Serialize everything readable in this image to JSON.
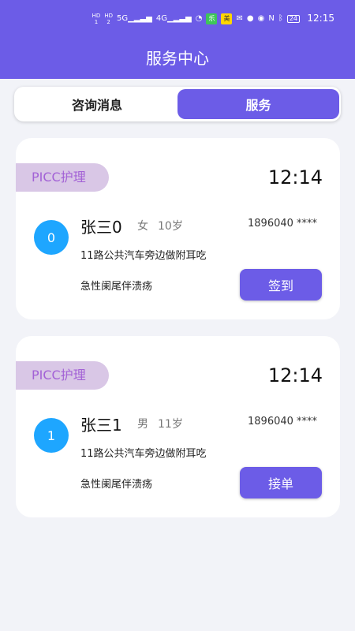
{
  "status_bar": {
    "icons": [
      {
        "name": "hd1-icon",
        "top": "HD",
        "bottom": "1"
      },
      {
        "name": "hd2-icon",
        "top": "HD",
        "bottom": "2"
      },
      {
        "name": "signal-5g-icon",
        "glyph": "5G▁▂▃▅"
      },
      {
        "name": "signal-4g-icon",
        "glyph": "4G▁▂▃▅"
      },
      {
        "name": "wifi-icon",
        "glyph": "◔"
      },
      {
        "name": "app-badge-green-icon",
        "glyph": "乐"
      },
      {
        "name": "app-badge-yellow-icon",
        "glyph": "美"
      },
      {
        "name": "wechat-icon",
        "glyph": "✉"
      },
      {
        "name": "chat-bubble-icon",
        "glyph": "●"
      },
      {
        "name": "eye-icon",
        "glyph": "◉"
      },
      {
        "name": "nfc-icon",
        "glyph": "N"
      },
      {
        "name": "bluetooth-icon",
        "glyph": "ᛒ"
      },
      {
        "name": "battery-icon",
        "glyph": "24"
      }
    ],
    "time": "12:15"
  },
  "header": {
    "title": "服务中心"
  },
  "tabs": [
    {
      "label": "咨询消息",
      "active": false
    },
    {
      "label": "服务",
      "active": true
    }
  ],
  "orders": [
    {
      "tag": "PICC护理",
      "time": "12:14",
      "avatar": "0",
      "name": "张三0",
      "sex": "女",
      "age": "10岁",
      "phone": "1896040 ****",
      "address": "11路公共汽车旁边做附耳吃",
      "diagnosis": "急性阑尾伴溃疡",
      "action": "签到"
    },
    {
      "tag": "PICC护理",
      "time": "12:14",
      "avatar": "1",
      "name": "张三1",
      "sex": "男",
      "age": "11岁",
      "phone": "1896040 ****",
      "address": "11路公共汽车旁边做附耳吃",
      "diagnosis": "急性阑尾伴溃疡",
      "action": "接单"
    }
  ],
  "colors": {
    "primary": "#6c5ce7",
    "tag_bg": "#d9c7e6",
    "tag_text": "#a362d6",
    "avatar": "#1ea6ff",
    "background": "#f2f3f8"
  }
}
